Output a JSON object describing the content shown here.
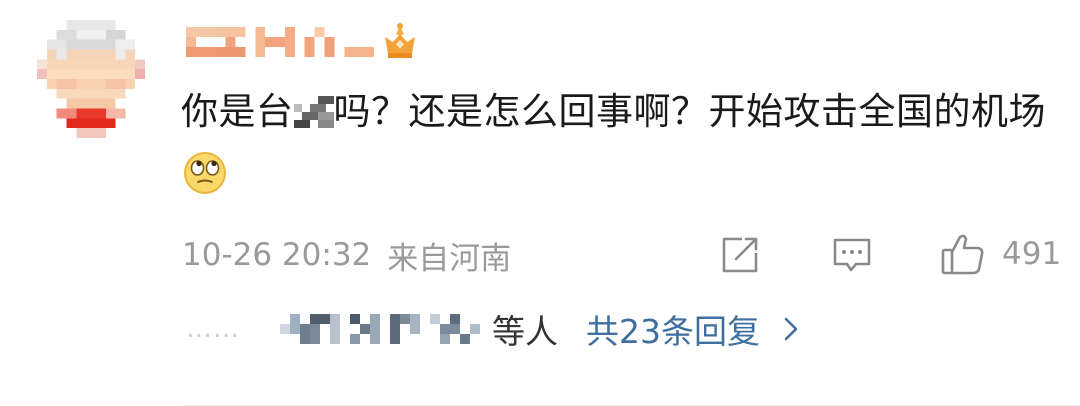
{
  "comment": {
    "text_part1": "你是台",
    "text_part2": "吗？还是怎么回事啊？开始攻击全国的机场",
    "timestamp": "10-26 20:32",
    "location": "来自河南",
    "like_count": "491"
  },
  "replies": {
    "dots": "……",
    "etc_label": "等人",
    "total_label": "共23条回复"
  },
  "icons": {
    "vip": "crown-badge-icon",
    "emoji": "rolling-eyes-emoji-icon",
    "share": "share-icon",
    "comment": "comment-icon",
    "like": "thumbs-up-icon",
    "chevron": "chevron-right-icon"
  },
  "colors": {
    "text": "#1a1a1a",
    "meta": "#9a9a9a",
    "link": "#3f6f9e",
    "vip": "#f2a33a"
  }
}
